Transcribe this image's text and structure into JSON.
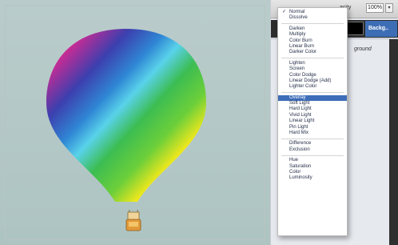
{
  "panel": {
    "opacity_label": "acity",
    "opacity_value": "100%",
    "stepper_glyph": "▾",
    "selected_layer_label": "Backg..",
    "background_layer_label": "ground"
  },
  "blend_menu": {
    "groups": [
      [
        {
          "label": "Normal",
          "checked": true
        },
        {
          "label": "Dissolve"
        }
      ],
      [
        {
          "label": "Darken"
        },
        {
          "label": "Multiply"
        },
        {
          "label": "Color Burn"
        },
        {
          "label": "Linear Burn"
        },
        {
          "label": "Darker Color"
        }
      ],
      [
        {
          "label": "Lighten"
        },
        {
          "label": "Screen"
        },
        {
          "label": "Color Dodge"
        },
        {
          "label": "Linear Dodge (Add)"
        },
        {
          "label": "Lighter Color"
        }
      ],
      [
        {
          "label": "Overlay",
          "highlighted": true
        },
        {
          "label": "Soft Light"
        },
        {
          "label": "Hard Light"
        },
        {
          "label": "Vivid Light"
        },
        {
          "label": "Linear Light"
        },
        {
          "label": "Pin Light"
        },
        {
          "label": "Hard Mix"
        }
      ],
      [
        {
          "label": "Difference"
        },
        {
          "label": "Exclusion"
        }
      ],
      [
        {
          "label": "Hue"
        },
        {
          "label": "Saturation"
        },
        {
          "label": "Color"
        },
        {
          "label": "Luminosity"
        }
      ]
    ],
    "check_glyph": "✓"
  },
  "canvas": {
    "subject": "hot-air-balloon",
    "gradient_colors": [
      "#e8145a",
      "#d4218f",
      "#3a3fb0",
      "#2f8fd6",
      "#4fd0e6",
      "#3dbf52",
      "#f2e81e",
      "#f59a1a",
      "#e82a1a"
    ]
  },
  "colors": {
    "highlight": "#3d6db8",
    "panel_dark": "#2d2d2d"
  }
}
